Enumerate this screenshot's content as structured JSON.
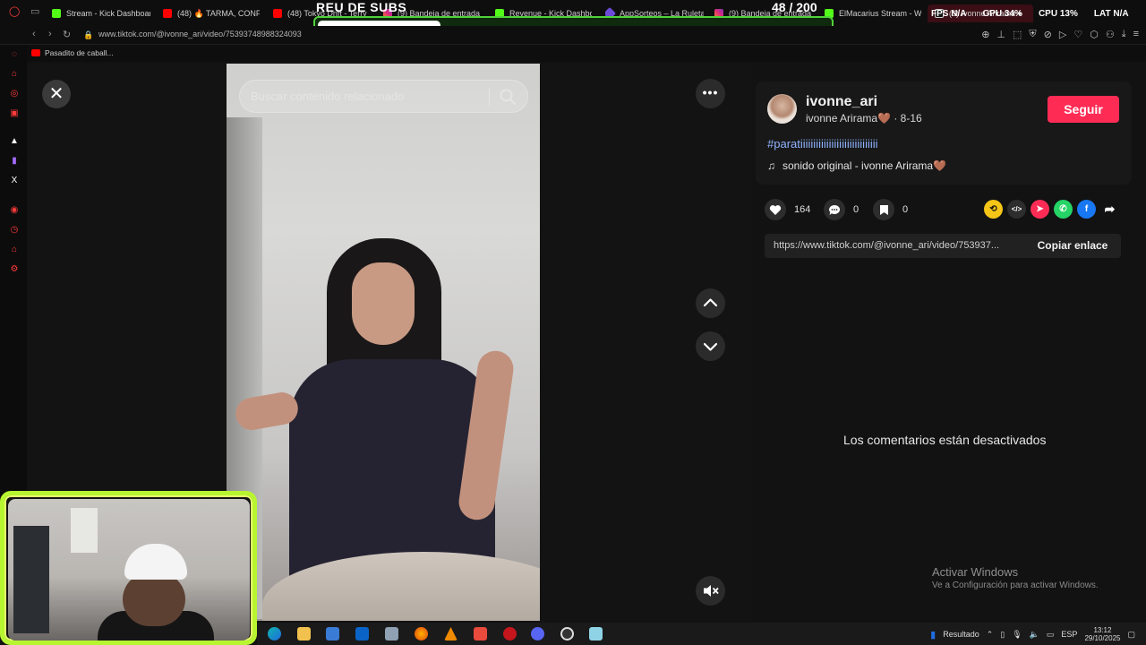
{
  "browser": {
    "tabs": [
      {
        "label": "Stream - Kick Dashboard",
        "favicon": "kick"
      },
      {
        "label": "(48) 🔥 TARMA, CONFE",
        "favicon": "youtube"
      },
      {
        "label": "(48) Tokyo Drift - Terry",
        "favicon": "youtube"
      },
      {
        "label": "(9) Bandeja de entrada",
        "favicon": "instagram"
      },
      {
        "label": "Revenue - Kick Dashbo",
        "favicon": "kick"
      },
      {
        "label": "AppSorteos – La Ruleta",
        "favicon": "appsorteos"
      },
      {
        "label": "(9) Bandeja de entrada",
        "favicon": "instagram"
      },
      {
        "label": "ElMacarius Stream - W",
        "favicon": "kick"
      },
      {
        "label": "(6) Ivonne Arirama ♦",
        "favicon": "tiktok"
      }
    ],
    "url": "www.tiktok.com/@ivonne_ari/video/75393748988324093",
    "bookmark": "Pasadito de caball..."
  },
  "stream_overlay": {
    "title": "REU DE SUBS",
    "count": "48",
    "goal": "/ 200",
    "progress": 0.24,
    "fps_label": "FPS",
    "fps_value": "N/A",
    "gpu_label": "GPU",
    "gpu_value": "34%",
    "cpu_label": "CPU",
    "cpu_value": "13%",
    "lat_label": "LAT",
    "lat_value": "N/A"
  },
  "viewer": {
    "search_placeholder": "Buscar contenido relacionado",
    "more_label": "•••"
  },
  "post": {
    "username": "ivonne_ari",
    "nickname": "ivonne Arirama🤎",
    "date": "· 8-16",
    "follow_label": "Seguir",
    "hashtag": "#parati",
    "hashtag_tail": "iiiiiiiiiiiiiiiiiiiiiiiiiiiii",
    "music": "sonido original - ivonne Arirama🤎",
    "likes": "164",
    "comments": "0",
    "saves": "0",
    "link": "https://www.tiktok.com/@ivonne_ari/video/753937...",
    "copy_label": "Copiar enlace",
    "comments_disabled": "Los comentarios están desactivados"
  },
  "windows": {
    "activate_title": "Activar Windows",
    "activate_sub": "Ve a Configuración para activar Windows.",
    "tray_label": "Resultado",
    "lang": "ESP",
    "time": "13:12",
    "date": "29/10/2025"
  },
  "colors": {
    "accent_follow": "#fe2c55",
    "hashtag": "#8fb3ff",
    "overlay_green": "#4fd23a",
    "webcam_border": "#b8f531"
  }
}
